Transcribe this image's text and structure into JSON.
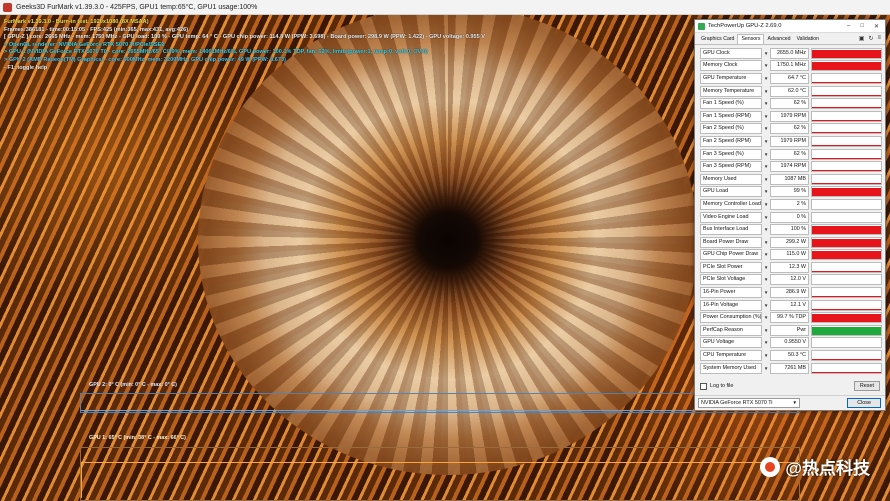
{
  "window": {
    "title": "Geeks3D FurMark v1.39.3.0 - 425FPS, GPU1 temp:65°C, GPU1 usage:100%"
  },
  "osd": {
    "lines": [
      {
        "text": "FurMark v1.39.3.0 - Burn-in test, 1920x1080 (8X MSAA)",
        "color": "yellow"
      },
      {
        "text": "Frames:386181 - time:00:15:05 - FPS:425 (min:365, max:431, avg:426)",
        "color": "white"
      },
      {
        "text": "[ GPU-Z ] core: 2665 MHz - mem: 1750 MHz - GPU load: 100 % - GPU temp: 64 ° C - GPU chip power: 114.8 W (PPW: 3.698) - Board power: 298.9 W (PPW: 1.422) - GPU voltage: 0.955 V",
        "color": "white"
      },
      {
        "text": "> OpenGL renderer: NVIDIA GeForce RTX 5070 Ti/PCIe/SSE2",
        "color": "cyan"
      },
      {
        "text": "> GPU 1 (NVIDIA GeForce RTX 5070 Ti) - core: 2655MHz/65° C/99%, mem: 14001MHz/6%, GPU power: 100.1% TDP, fan: 62%, limits(power:1, temp:0, volt:0, OV:0)",
        "color": "cyan"
      },
      {
        "text": "> GPU 2 (AMD Radeon(TM) Graphics) - core: 600MHz, mem: 3200MHz, GPU chip power: 49 W (PPW: 8.673)",
        "color": "gpu2"
      },
      {
        "text": "- F1: toggle help",
        "color": "white"
      }
    ],
    "colors": {
      "yellow": "#f6e24a",
      "white": "#f0f0f0",
      "cyan": "#38d3f0",
      "gpu2": "#46c6f6"
    }
  },
  "graphs": {
    "gpu2_label": "GPU 2: 0° C (min: 0° C - max: 0° C)",
    "gpu1_label": "GPU 1: 65° C (min: 38° C - max: 66° C)"
  },
  "watermark": {
    "text": "@热点科技"
  },
  "gpuz": {
    "title": "TechPowerUp GPU-Z 2.69.0",
    "tabs": [
      "Graphics Card",
      "Sensors",
      "Advanced",
      "Validation"
    ],
    "active_tab": "Sensors",
    "window_buttons": {
      "minimize": "–",
      "maximize": "□",
      "close": "✕"
    },
    "tool_icons": [
      "camera-icon",
      "refresh-icon",
      "menu-icon"
    ],
    "sensors": [
      {
        "label": "GPU Clock",
        "value": "2655.0 MHz",
        "level": 0.9
      },
      {
        "label": "Memory Clock",
        "value": "1750.1 MHz",
        "level": 0.9
      },
      {
        "label": "GPU Temperature",
        "value": "64.7 °C",
        "level": 0.1
      },
      {
        "label": "Memory Temperature",
        "value": "62.0 °C",
        "level": 0.1
      },
      {
        "label": "Fan 1 Speed (%)",
        "value": "62 %",
        "level": 0.1
      },
      {
        "label": "Fan 1 Speed (RPM)",
        "value": "1979 RPM",
        "level": 0.1
      },
      {
        "label": "Fan 2 Speed (%)",
        "value": "62 %",
        "level": 0.1
      },
      {
        "label": "Fan 2 Speed (RPM)",
        "value": "1979 RPM",
        "level": 0.1
      },
      {
        "label": "Fan 3 Speed (%)",
        "value": "62 %",
        "level": 0.1
      },
      {
        "label": "Fan 3 Speed (RPM)",
        "value": "1974 RPM",
        "level": 0.1
      },
      {
        "label": "Memory Used",
        "value": "1087 MB",
        "level": 0.1
      },
      {
        "label": "GPU Load",
        "value": "99 %",
        "level": 0.9
      },
      {
        "label": "Memory Controller Load",
        "value": "2 %",
        "level": 0.0
      },
      {
        "label": "Video Engine Load",
        "value": "0 %",
        "level": 0.0
      },
      {
        "label": "Bus Interface Load",
        "value": "100 %",
        "level": 0.9
      },
      {
        "label": "Board Power Draw",
        "value": "299.2 W",
        "level": 0.9
      },
      {
        "label": "GPU Chip Power Draw",
        "value": "115.0 W",
        "level": 0.9
      },
      {
        "label": "PCIe Slot Power",
        "value": "12.3 W",
        "level": 0.1
      },
      {
        "label": "PCIe Slot Voltage",
        "value": "12.0 V",
        "level": 0.1
      },
      {
        "label": "16-Pin Power",
        "value": "286.9 W",
        "level": 0.1
      },
      {
        "label": "16-Pin Voltage",
        "value": "12.1 V",
        "level": 0.1
      },
      {
        "label": "Power Consumption (%)",
        "value": "99.7 % TDP",
        "level": 0.9
      },
      {
        "label": "PerfCap Reason",
        "value": "Pwr",
        "level": 0.9,
        "color": "#1fa83c"
      },
      {
        "label": "GPU Voltage",
        "value": "0.9550 V",
        "level": 0.1
      },
      {
        "label": "CPU Temperature",
        "value": "50.3 °C",
        "level": 0.1
      },
      {
        "label": "System Memory Used",
        "value": "7261 MB",
        "level": 0.1
      }
    ],
    "bar_color": "#e8141c",
    "log_to_file": "Log to file",
    "reset": "Reset",
    "gpu_select": "NVIDIA GeForce RTX 5070 Ti",
    "close": "Close"
  }
}
